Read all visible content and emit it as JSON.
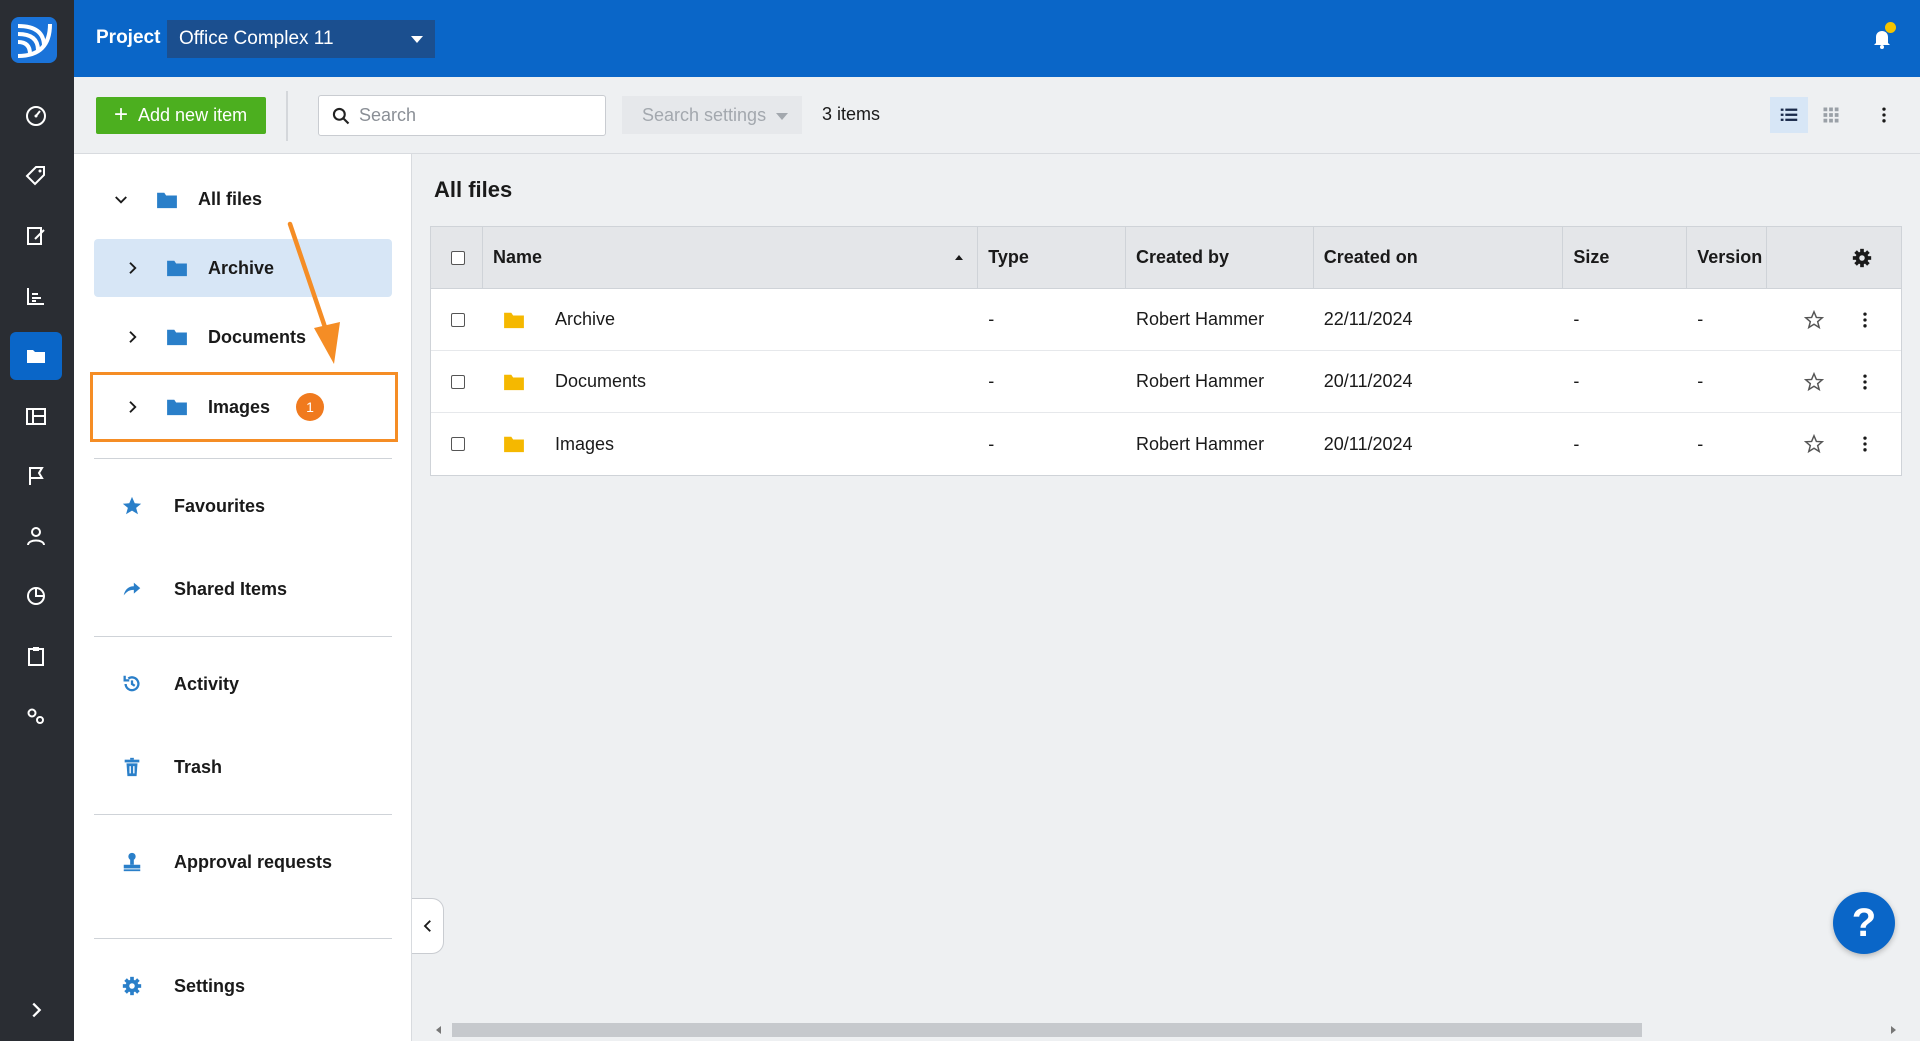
{
  "topbar": {
    "project_label": "Project",
    "project_name": "Office Complex 11"
  },
  "toolbar": {
    "add_label": "Add new item",
    "search_placeholder": "Search",
    "search_settings_label": "Search settings",
    "item_count": "3 items"
  },
  "sidebar": {
    "root": "All files",
    "children": [
      {
        "label": "Archive"
      },
      {
        "label": "Documents"
      },
      {
        "label": "Images",
        "badge": "1"
      }
    ],
    "nav": {
      "favourites": "Favourites",
      "shared": "Shared Items",
      "activity": "Activity",
      "trash": "Trash",
      "approval": "Approval requests",
      "settings": "Settings"
    }
  },
  "main": {
    "title": "All files",
    "columns": [
      "Name",
      "Type",
      "Created by",
      "Created on",
      "Size",
      "Version"
    ],
    "rows": [
      {
        "name": "Archive",
        "type": "-",
        "created_by": "Robert Hammer",
        "created_on": "22/11/2024",
        "size": "-",
        "version": "-"
      },
      {
        "name": "Documents",
        "type": "-",
        "created_by": "Robert Hammer",
        "created_on": "20/11/2024",
        "size": "-",
        "version": "-"
      },
      {
        "name": "Images",
        "type": "-",
        "created_by": "Robert Hammer",
        "created_on": "20/11/2024",
        "size": "-",
        "version": "-"
      }
    ]
  },
  "help_label": "?",
  "colors": {
    "brand_blue": "#0a66c8",
    "add_green": "#4caf1f",
    "folder_yellow": "#f5b800",
    "highlight_orange": "#f58d25"
  }
}
